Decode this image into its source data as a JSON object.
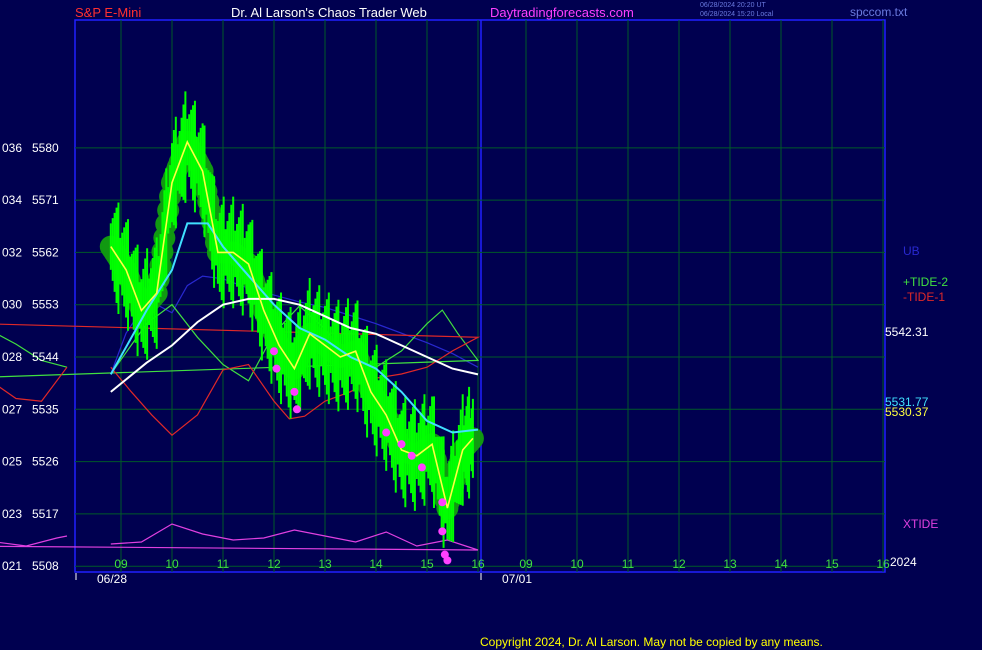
{
  "header": {
    "left": "S&P E-Mini",
    "center": "Dr. Al Larson's Chaos Trader Web",
    "site": "Daytradingforecasts.com",
    "timestamp1": "06/28/2024 20:20 UT",
    "timestamp2": "06/28/2024 15:20 Local",
    "file": "spccom.txt"
  },
  "footer": {
    "copyright": "Copyright 2024, Dr. Al Larson. May not be copied by any means."
  },
  "colors": {
    "background": "#000050",
    "frame": "#2020ff",
    "grid": "#005a28",
    "price": "#00ff00",
    "halo": "#119911",
    "signal": "#ff40ff",
    "ma_fast": "#ffff40",
    "ma_mid": "#40e0ff",
    "ma_slow": "#ffffff",
    "band": "#2828d0",
    "tide2": "#40e040",
    "tide1": "#e02828",
    "xtide": "#e040e0"
  },
  "chart_data": {
    "type": "line",
    "y_axis": {
      "ticks": [
        5508,
        5517,
        5526,
        5535,
        5544,
        5553,
        5562,
        5571,
        5580
      ],
      "secondary_ticks": [
        "021",
        "023",
        "025",
        "027",
        "028",
        "030",
        "032",
        "034",
        "036"
      ],
      "range": [
        5507,
        5602
      ]
    },
    "x_axis": {
      "hour_ticks": [
        "09",
        "10",
        "11",
        "12",
        "13",
        "14",
        "15",
        "16",
        "09",
        "10",
        "11",
        "12",
        "13",
        "14",
        "15",
        "16"
      ],
      "date_labels": [
        "06/28",
        "07/01"
      ],
      "year_label": "2024"
    },
    "price": {
      "name": "S&P E-Mini",
      "last": 5530.37,
      "x": [
        8.8,
        9.1,
        9.4,
        9.7,
        10.0,
        10.3,
        10.6,
        10.9,
        11.2,
        11.5,
        11.8,
        12.1,
        12.4,
        12.7,
        13.0,
        13.3,
        13.6,
        13.9,
        14.2,
        14.5,
        14.8,
        15.1,
        15.4,
        15.7,
        15.9
      ],
      "y": [
        5563,
        5559,
        5552,
        5555,
        5574,
        5581,
        5576,
        5562,
        5562,
        5560,
        5552,
        5546,
        5542,
        5548,
        5546,
        5544,
        5545,
        5538,
        5534,
        5528,
        5527,
        5529,
        5518,
        5528,
        5530
      ]
    },
    "moving_averages": [
      {
        "label": "5531.77",
        "last": 5531.77,
        "x": [
          8.8,
          9.5,
          10.0,
          10.3,
          10.7,
          11.0,
          11.5,
          12.0,
          12.5,
          13.0,
          13.5,
          14.0,
          14.5,
          15.0,
          15.5,
          16.0
        ],
        "y": [
          5541,
          5552,
          5559,
          5567,
          5567,
          5563,
          5558,
          5553,
          5549,
          5547,
          5544,
          5542,
          5538,
          5533,
          5531,
          5531.5
        ]
      },
      {
        "label": "5542.31",
        "last": 5542.31,
        "x": [
          8.8,
          9.5,
          10.0,
          10.5,
          11.0,
          11.5,
          12.0,
          12.5,
          13.0,
          13.5,
          14.0,
          14.5,
          15.0,
          15.5,
          16.0
        ],
        "y": [
          5538,
          5543,
          5546,
          5550,
          5553,
          5554,
          5554,
          5553,
          5551,
          5549,
          5548,
          5546,
          5544,
          5542,
          5541
        ]
      }
    ],
    "lanes": {
      "mid": [
        {
          "label": "UB",
          "x": [
            8.8,
            9.1,
            9.4,
            9.7,
            10.0,
            10.3,
            10.6,
            11.0,
            11.5,
            12.0,
            12.5,
            13.0,
            13.5,
            14.0,
            14.5,
            15.0,
            15.5,
            16.0
          ],
          "y": [
            0.25,
            0.55,
            0.72,
            0.76,
            0.7,
            0.9,
            0.97,
            0.95,
            0.88,
            0.83,
            0.78,
            0.74,
            0.68,
            0.62,
            0.55,
            0.48,
            0.4,
            0.3
          ]
        },
        {
          "label": "+TIDE-2",
          "x": [
            8.8,
            9.5,
            10.0,
            10.5,
            11.0,
            11.5,
            12.0,
            12.5,
            13.0,
            13.5,
            14.0,
            14.5,
            15.0,
            15.3,
            15.6,
            16.0,
            16.5,
            17.0,
            17.5,
            18.0,
            18.5,
            19.0,
            19.5,
            20.0,
            20.5,
            21.0,
            21.5,
            22.0,
            22.5,
            23.0,
            23.5,
            24.0
          ],
          "y": [
            0.25,
            0.62,
            0.76,
            0.52,
            0.32,
            0.2,
            0.55,
            0.75,
            0.58,
            0.35,
            0.3,
            0.42,
            0.62,
            0.72,
            0.55,
            0.35,
            0.15,
            0.0,
            0.08,
            0.22,
            0.3,
            0.32,
            0.28,
            0.18,
            0.22,
            0.12,
            0.35,
            0.52,
            0.57,
            0.47,
            0.35,
            0.3
          ]
        },
        {
          "label": "-TIDE-1",
          "x": [
            8.8,
            9.2,
            9.6,
            10.0,
            10.5,
            11.0,
            11.5,
            12.0,
            12.3,
            12.6,
            13.0,
            13.5,
            14.0,
            14.5,
            15.0,
            15.5,
            16.0,
            16.5,
            17.0,
            17.5,
            18.0,
            18.5,
            19.0,
            19.5,
            20.0,
            20.5,
            21.0,
            21.5,
            22.0,
            22.5,
            23.0,
            23.5,
            24.0
          ],
          "y": [
            0.3,
            0.12,
            -0.05,
            -0.2,
            -0.05,
            0.28,
            0.32,
            0.05,
            -0.08,
            -0.06,
            0.05,
            0.12,
            0.22,
            0.25,
            0.3,
            0.42,
            0.52,
            0.68,
            0.75,
            0.62,
            0.4,
            0.32,
            0.3,
            0.33,
            0.28,
            0.3,
            0.42,
            0.47,
            0.43,
            0.2,
            0.07,
            0.05,
            0.3
          ]
        }
      ],
      "bottom": [
        {
          "label": "XTIDE",
          "x": [
            8.8,
            9.4,
            10.0,
            10.6,
            11.2,
            11.8,
            12.4,
            13.0,
            13.6,
            14.2,
            14.8,
            15.4,
            16.0,
            16.6,
            17.2,
            17.8,
            18.4,
            19.0,
            19.6,
            20.2,
            20.8,
            21.4,
            22.0,
            22.6,
            23.2,
            23.8,
            24.0
          ],
          "y": [
            0.35,
            0.4,
            0.85,
            0.6,
            0.45,
            0.5,
            0.7,
            0.55,
            0.4,
            0.65,
            0.3,
            0.45,
            0.2,
            0.35,
            0.6,
            0.55,
            0.3,
            0.5,
            0.8,
            0.45,
            0.85,
            0.7,
            0.55,
            0.4,
            0.3,
            0.5,
            0.55
          ]
        }
      ]
    }
  }
}
